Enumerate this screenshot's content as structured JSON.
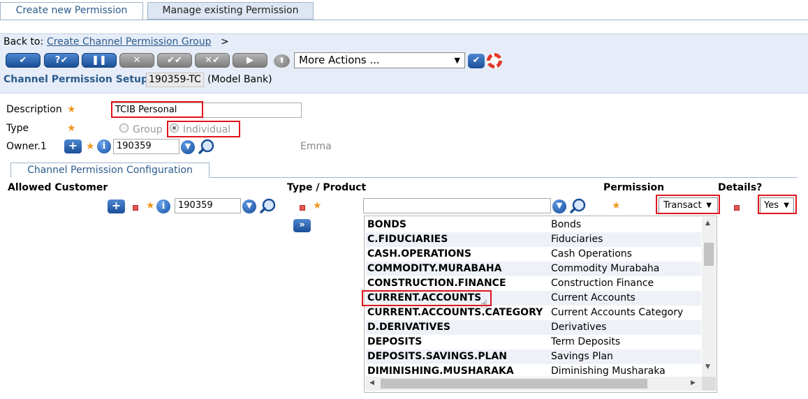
{
  "tabs": [
    {
      "label": "Create new Permission",
      "active": true
    },
    {
      "label": "Manage existing Permission",
      "active": false
    }
  ],
  "back": {
    "prefix": "Back to:",
    "link": "Create Channel Permission Group",
    "suffix": ">"
  },
  "toolbar": {
    "more_actions": "More Actions ..."
  },
  "record": {
    "title": "Channel Permission Setups",
    "id": "190359-TC",
    "company": "(Model Bank)"
  },
  "form": {
    "description_label": "Description",
    "description_value": "TCIB Personal",
    "type_label": "Type",
    "type_option_group": "Group",
    "type_option_individual": "Individual",
    "type_selected": "Individual",
    "owner_label": "Owner.1",
    "owner_value": "190359",
    "owner_name": "Emma"
  },
  "section_tab": "Channel Permission Configuration",
  "grid": {
    "headers": {
      "allowed_customer": "Allowed Customer",
      "type_product": "Type / Product",
      "permission": "Permission",
      "details": "Details?"
    },
    "customer_value": "190359",
    "type_product_value": "",
    "permission_value": "Transact",
    "details_value": "Yes"
  },
  "dropdown": {
    "items": [
      {
        "code": "BONDS",
        "desc": "Bonds"
      },
      {
        "code": "C.FIDUCIARIES",
        "desc": "Fiduciaries"
      },
      {
        "code": "CASH.OPERATIONS",
        "desc": "Cash Operations"
      },
      {
        "code": "COMMODITY.MURABAHA",
        "desc": "Commodity Murabaha"
      },
      {
        "code": "CONSTRUCTION.FINANCE",
        "desc": "Construction Finance"
      },
      {
        "code": "CURRENT.ACCOUNTS",
        "desc": "Current Accounts",
        "highlighted": true
      },
      {
        "code": "CURRENT.ACCOUNTS.CATEGORY",
        "desc": "Current Accounts Category"
      },
      {
        "code": "D.DERIVATIVES",
        "desc": "Derivatives"
      },
      {
        "code": "DEPOSITS",
        "desc": "Term Deposits"
      },
      {
        "code": "DEPOSITS.SAVINGS.PLAN",
        "desc": "Savings Plan"
      },
      {
        "code": "DIMINISHING.MUSHARAKA",
        "desc": "Diminishing Musharaka"
      }
    ]
  },
  "colors": {
    "accent": "#2c5b8c",
    "highlight_box": "#e0141c",
    "required_star": "#f0961e",
    "toolbar_bg": "#e6edf8"
  }
}
